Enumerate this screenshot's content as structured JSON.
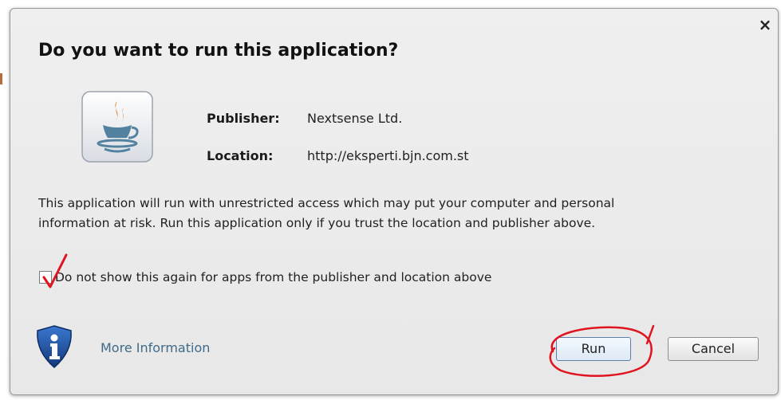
{
  "dialog": {
    "title": "Do you want to run this application?",
    "close_glyph": "×",
    "app_icon": "java-coffee-cup-icon"
  },
  "info": {
    "publisher_label": "Publisher:",
    "publisher_value": "Nextsense Ltd.",
    "location_label": "Location:",
    "location_value": "http://eksperti.bjn.com.st"
  },
  "warning": {
    "line1": "This application will run with unrestricted access which may put your computer and personal",
    "line2": "information at risk. Run this application only if you trust the location and publisher above."
  },
  "checkbox": {
    "label": "Do not show this again for apps from the publisher and location above",
    "checked": true
  },
  "footer": {
    "info_icon": "shield-info-icon",
    "more_info_label": "More Information",
    "run_label": "Run",
    "cancel_label": "Cancel"
  },
  "colors": {
    "link": "#3f6a8a",
    "annotation_red": "#e0141e",
    "shield_blue": "#1f4f9c"
  }
}
